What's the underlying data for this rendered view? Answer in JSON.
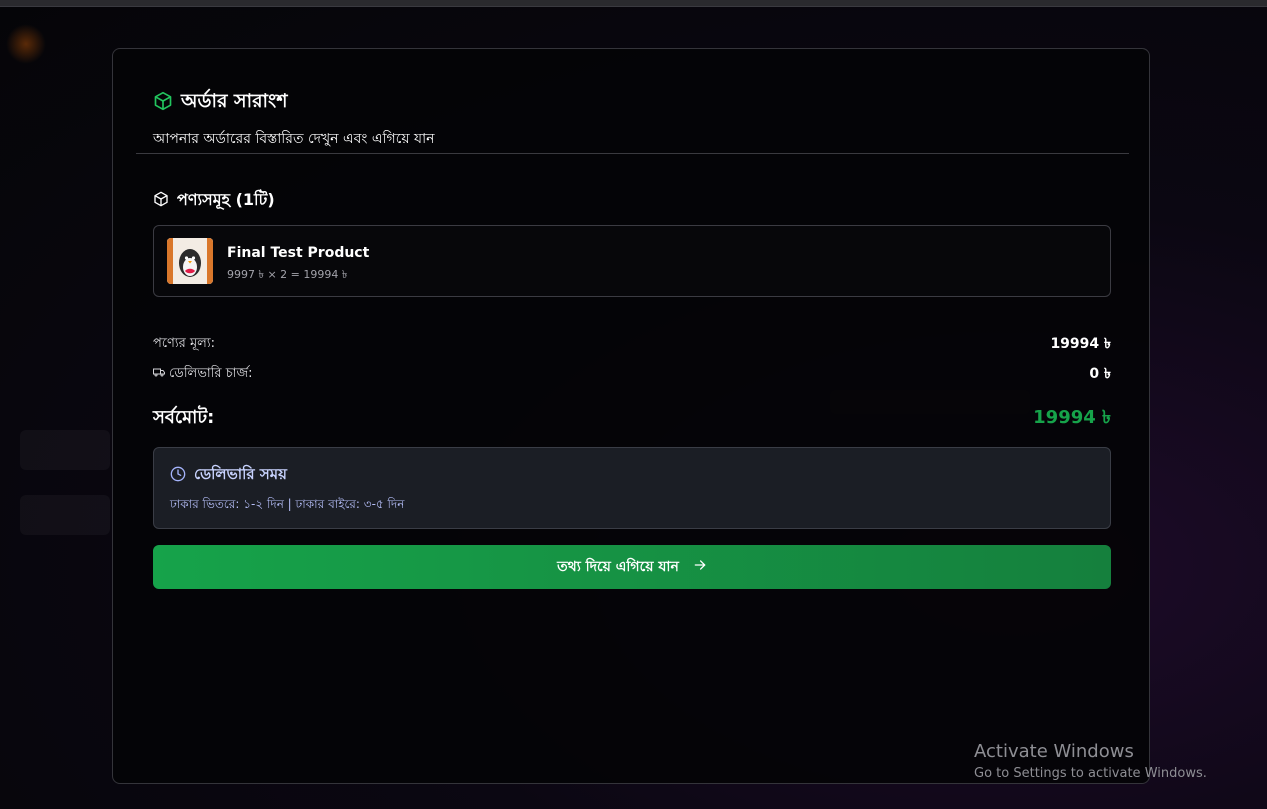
{
  "order_summary": {
    "title": "অর্ডার সারাংশ",
    "subtitle": "আপনার অর্ডারের বিস্তারিত দেখুন এবং এগিয়ে যান",
    "items_title": "পণ্যসমূহ (1টি)",
    "items": [
      {
        "name": "Final Test Product",
        "price_line": "9997 ৳ × 2 = 19994 ৳"
      }
    ],
    "product_price_label": "পণ্যের মূল্য:",
    "product_price_value": "19994 ৳",
    "delivery_charge_label": "ডেলিভারি চার্জ:",
    "delivery_charge_value": "0 ৳",
    "total_label": "সর্বমোট:",
    "total_value": "19994 ৳",
    "delivery_time_title": "ডেলিভারি সময়",
    "delivery_time_text": "ঢাকার ভিতরে: ১-২ দিন | ঢাকার বাইরে: ৩-৫ দিন",
    "proceed_button": "তথ্য দিয়ে এগিয়ে যান"
  },
  "colors": {
    "accent_green": "#16a34a",
    "delivery_accent": "#a5b4fc"
  },
  "watermark": {
    "line1": "Activate Windows",
    "line2": "Go to Settings to activate Windows."
  }
}
